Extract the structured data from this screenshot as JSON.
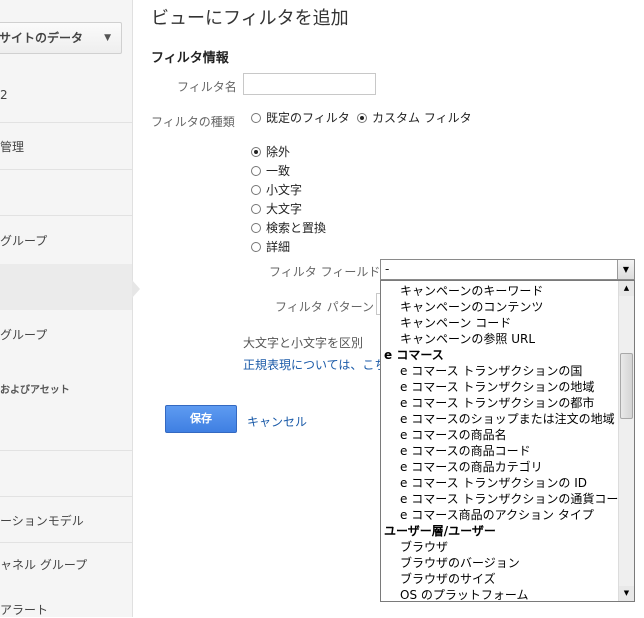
{
  "sidebar": {
    "account_dropdown": "サイトのデータ",
    "items": [
      {
        "label": "2"
      },
      {
        "label": "管理"
      },
      {
        "label": "グループ"
      },
      {
        "label": ""
      },
      {
        "label": "グループ"
      },
      {
        "label": "ーションモデル"
      },
      {
        "label": "ャネル グループ"
      },
      {
        "label": "アラート"
      }
    ],
    "section_label": "およびアセット"
  },
  "page": {
    "title": "ビューにフィルタを追加",
    "section_heading": "フィルタ情報",
    "filter_name_label": "フィルタ名",
    "filter_name_value": "",
    "filter_type_label": "フィルタの種類",
    "type_options": {
      "predefined": "既定のフィルタ",
      "custom": "カスタム フィルタ"
    },
    "custom_options": [
      "除外",
      "一致",
      "小文字",
      "大文字",
      "検索と置換",
      "詳細"
    ],
    "filter_field_label": "フィルタ フィールド",
    "filter_field_value": "-",
    "filter_pattern_label": "フィルタ パターン",
    "case_label": "大文字と小文字を区別",
    "regex_link": "正規表現については、こち",
    "save_label": "保存",
    "cancel_label": "キャンセル"
  },
  "dropdown": {
    "groups": [
      {
        "heading": "",
        "options": [
          "キャンペーンのキーワード",
          "キャンペーンのコンテンツ",
          "キャンペーン コード",
          "キャンペーンの参照 URL"
        ]
      },
      {
        "heading": "e コマース",
        "options": [
          "e コマース トランザクションの国",
          "e コマース トランザクションの地域",
          "e コマース トランザクションの都市",
          "e コマースのショップまたは注文の地域",
          "e コマースの商品名",
          "e コマースの商品コード",
          "e コマースの商品カテゴリ",
          "e コマース トランザクションの ID",
          "e コマース トランザクションの通貨コード",
          "e コマース商品のアクション タイプ"
        ]
      },
      {
        "heading": "ユーザー層/ユーザー",
        "options": [
          "ブラウザ",
          "ブラウザのバージョン",
          "ブラウザのサイズ",
          "OS のプラットフォーム"
        ]
      }
    ]
  }
}
